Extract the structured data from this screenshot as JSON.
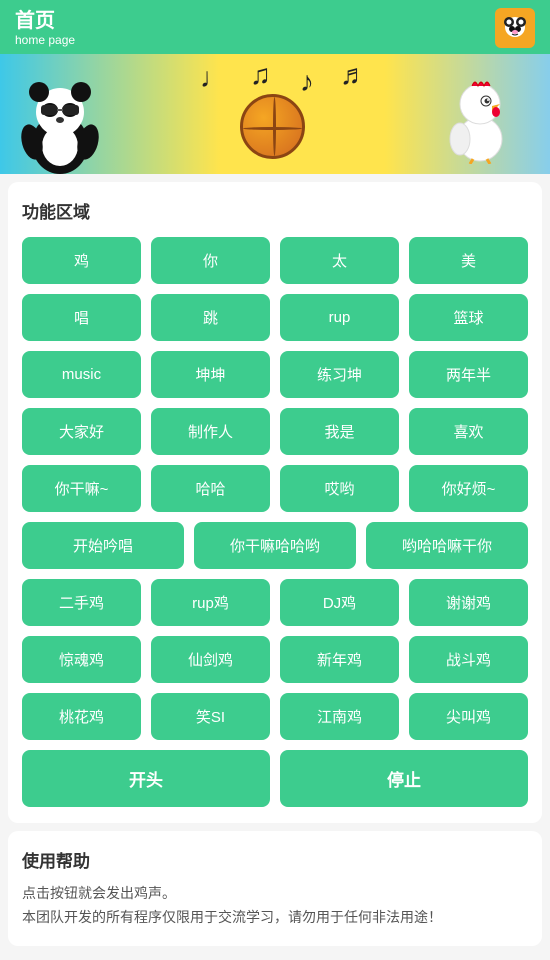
{
  "header": {
    "title": "首页",
    "subtitle": "home page",
    "avatar_label": "panda-avatar"
  },
  "banner": {
    "notes": [
      "♩",
      "♪",
      "♫",
      "♬"
    ]
  },
  "sections": {
    "function_area": {
      "title": "功能区域",
      "rows": [
        [
          "鸡",
          "你",
          "太",
          "美"
        ],
        [
          "唱",
          "跳",
          "rup",
          "篮球"
        ],
        [
          "music",
          "坤坤",
          "练习坤",
          "两年半"
        ],
        [
          "大家好",
          "制作人",
          "我是",
          "喜欢"
        ],
        [
          "你干嘛~",
          "哈哈",
          "哎哟",
          "你好烦~"
        ]
      ],
      "row3": [
        "开始吟唱",
        "你干嘛哈哈哟",
        "哟哈哈嘛干你"
      ],
      "row4_4": [
        "二手鸡",
        "rup鸡",
        "DJ鸡",
        "谢谢鸡"
      ],
      "row5_4": [
        "惊魂鸡",
        "仙剑鸡",
        "新年鸡",
        "战斗鸡"
      ],
      "row6_4": [
        "桃花鸡",
        "笑SI",
        "江南鸡",
        "尖叫鸡"
      ]
    },
    "actions": {
      "start": "开头",
      "stop": "停止"
    },
    "help": {
      "title": "使用帮助",
      "line1": "点击按钮就会发出鸡声。",
      "line2": "本团队开发的所有程序仅限用于交流学习，请勿用于任何非法用途！"
    }
  }
}
